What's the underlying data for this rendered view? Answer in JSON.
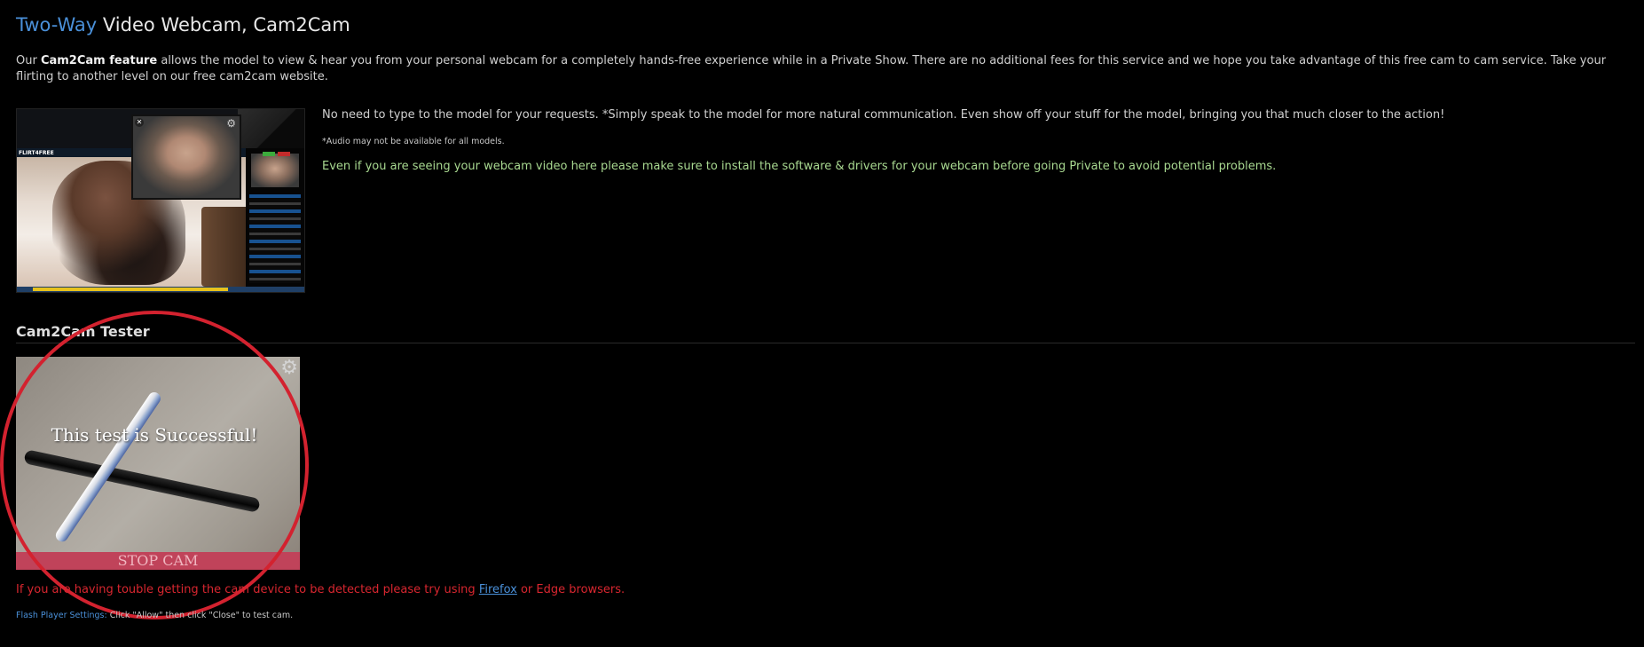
{
  "header": {
    "title_accent": "Two-Way",
    "title_rest": " Video Webcam, Cam2Cam"
  },
  "intro": {
    "prefix": "Our ",
    "bold": "Cam2Cam feature",
    "suffix": " allows the model to view & hear you from your personal webcam for a completely hands-free experience while in a Private Show. There are no additional fees for this service and we hope you take advantage of this free cam to cam service. Take your flirting to another level on our free cam2cam website."
  },
  "preview": {
    "brand": "FLIRT4FREE"
  },
  "info": {
    "line1": "No need to type to the model for your requests. *Simply speak to the model for more natural communication. Even show off your stuff for the model, bringing you that much closer to the action!",
    "note": "*Audio may not be available for all models.",
    "tip": "Even if you are seeing your webcam video here please make sure to install the software & drivers for your webcam before going Private to avoid potential problems."
  },
  "tester": {
    "section_title": "Cam2Cam Tester",
    "status_message": "This test is Successful!",
    "stop_label": "STOP CAM"
  },
  "warning": {
    "prefix": "If you are having touble getting the cam device to be detected please try using ",
    "link": "Firefox",
    "suffix": " or Edge browsers."
  },
  "flash": {
    "label": "Flash Player Settings:",
    "text": " Click \"Allow\" then click \"Close\" to test cam."
  },
  "colors": {
    "accent": "#4a90d9",
    "warning": "#d8262f",
    "tip": "#a8d890",
    "stop_button": "#c0435a",
    "annotation_circle": "#d3222f"
  },
  "icons": [
    "close-icon",
    "gear-icon",
    "settings-gear-icon"
  ]
}
